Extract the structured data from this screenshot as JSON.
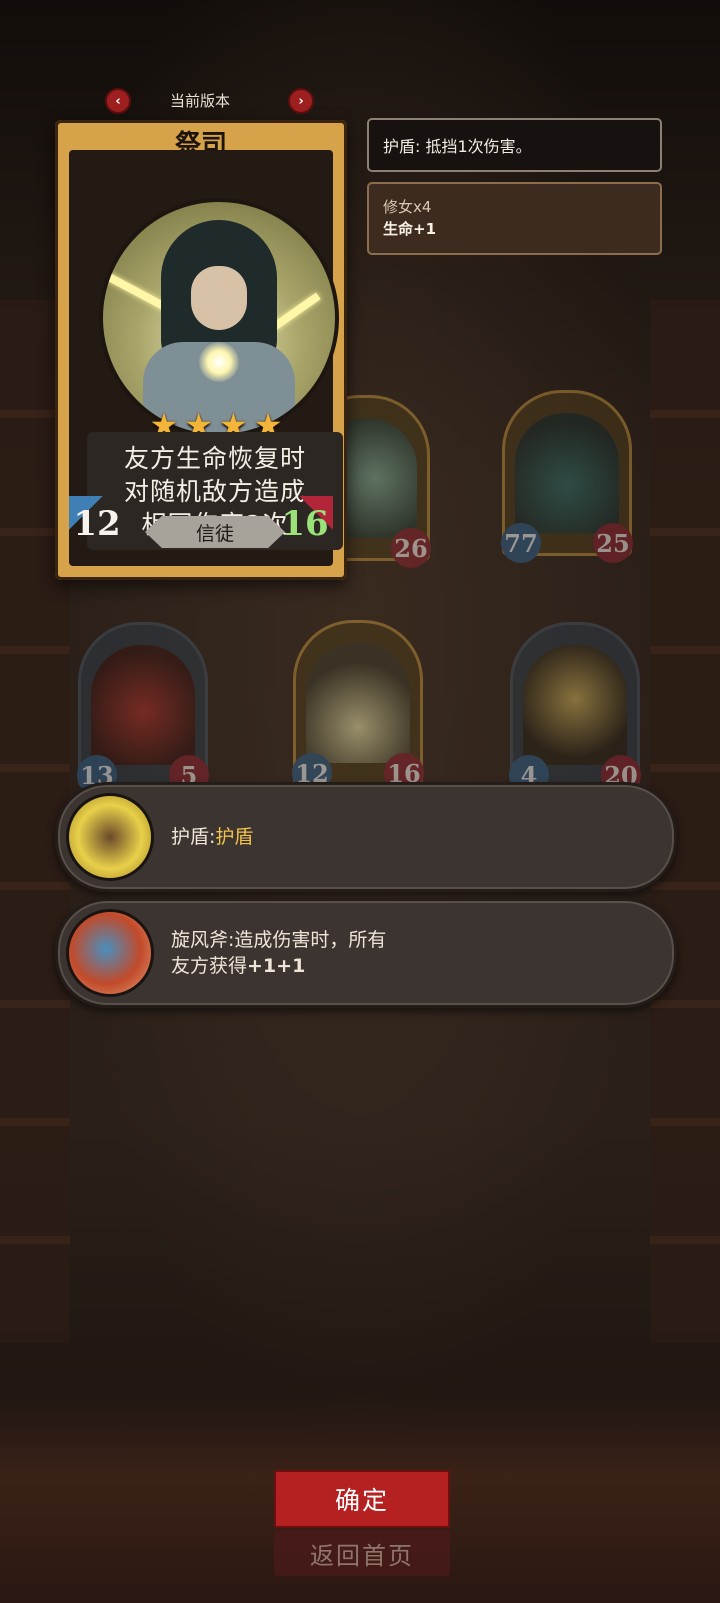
{
  "version": {
    "label": "当前版本",
    "prev_icon": "chevron-left-icon",
    "next_icon": "chevron-right-icon"
  },
  "card": {
    "name": "祭司",
    "stars": 4,
    "ability_lines": [
      "友方生命恢复时",
      "对随机敌方造成",
      "相同伤害2次"
    ],
    "attack": "12",
    "health": "16",
    "type": "信徒"
  },
  "tooltips": {
    "shield": "护盾: 抵挡1次伤害。",
    "buff_line1": "修女x4",
    "buff_line2": "生命+1"
  },
  "board": [
    {
      "attack": "77",
      "health": "25",
      "name": "serpent"
    },
    {
      "attack": "",
      "health": "26",
      "name": "fairy"
    },
    {
      "attack": "13",
      "health": "5",
      "name": "knight"
    },
    {
      "attack": "12",
      "health": "16",
      "name": "priest"
    },
    {
      "attack": "4",
      "health": "20",
      "name": "wizard"
    }
  ],
  "items": [
    {
      "label": "护盾:",
      "value": "护盾",
      "icon": "shield-badge-icon"
    },
    {
      "line1": "旋风斧:造成伤害时，所有",
      "line2_prefix": "友方获得",
      "line2_value": "+1+1",
      "icon": "whirlwind-axe-icon"
    }
  ],
  "buttons": {
    "confirm": "确定",
    "back": "返回首页"
  },
  "colors": {
    "confirm_red": "#b52020",
    "highlight_gold": "#f1c24a",
    "card_frame": "#d6a24a"
  }
}
